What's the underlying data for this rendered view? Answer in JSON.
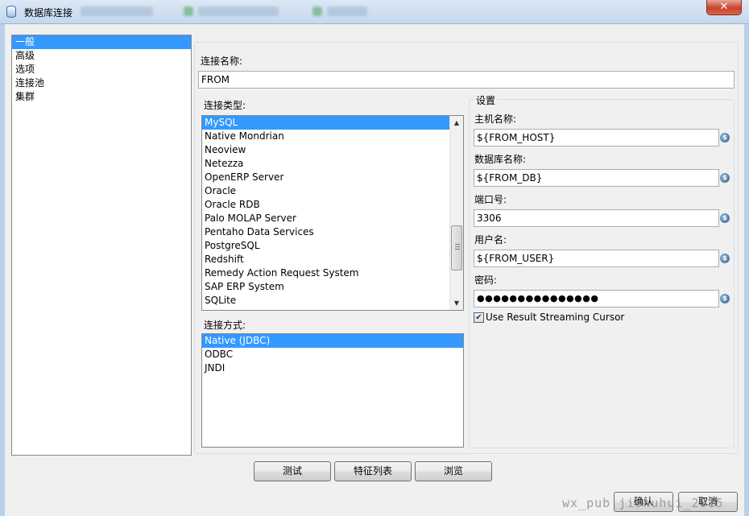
{
  "window": {
    "title": "数据库连接",
    "close_glyph": "✕"
  },
  "categories": [
    "一般",
    "高级",
    "选项",
    "连接池",
    "集群"
  ],
  "connection_name": {
    "label": "连接名称:",
    "value": "FROM"
  },
  "connection_type": {
    "label": "连接类型:",
    "items": [
      "MySQL",
      "Native Mondrian",
      "Neoview",
      "Netezza",
      "OpenERP Server",
      "Oracle",
      "Oracle RDB",
      "Palo MOLAP Server",
      "Pentaho Data Services",
      "PostgreSQL",
      "Redshift",
      "Remedy Action Request System",
      "SAP ERP System",
      "SQLite"
    ],
    "selected": "MySQL"
  },
  "access": {
    "label": "连接方式:",
    "items": [
      "Native (JDBC)",
      "ODBC",
      "JNDI"
    ],
    "selected": "Native (JDBC)"
  },
  "settings": {
    "caption": "设置",
    "host_label": "主机名称:",
    "host_value": "${FROM_HOST}",
    "db_label": "数据库名称:",
    "db_value": "${FROM_DB}",
    "port_label": "端口号:",
    "port_value": "3306",
    "user_label": "用户名:",
    "user_value": "${FROM_USER}",
    "password_label": "密码:",
    "password_value": "●●●●●●●●●●●●●●●",
    "streaming_cursor_label": "Use Result Streaming Cursor",
    "streaming_cursor_checked": true,
    "check_glyph": "✔",
    "var_glyph": "$"
  },
  "buttons": {
    "test": "测试",
    "feature_list": "特征列表",
    "explore": "浏览",
    "ok": "确认",
    "cancel": "取消"
  },
  "watermark": "wx_pub   jishuhui_2015"
}
